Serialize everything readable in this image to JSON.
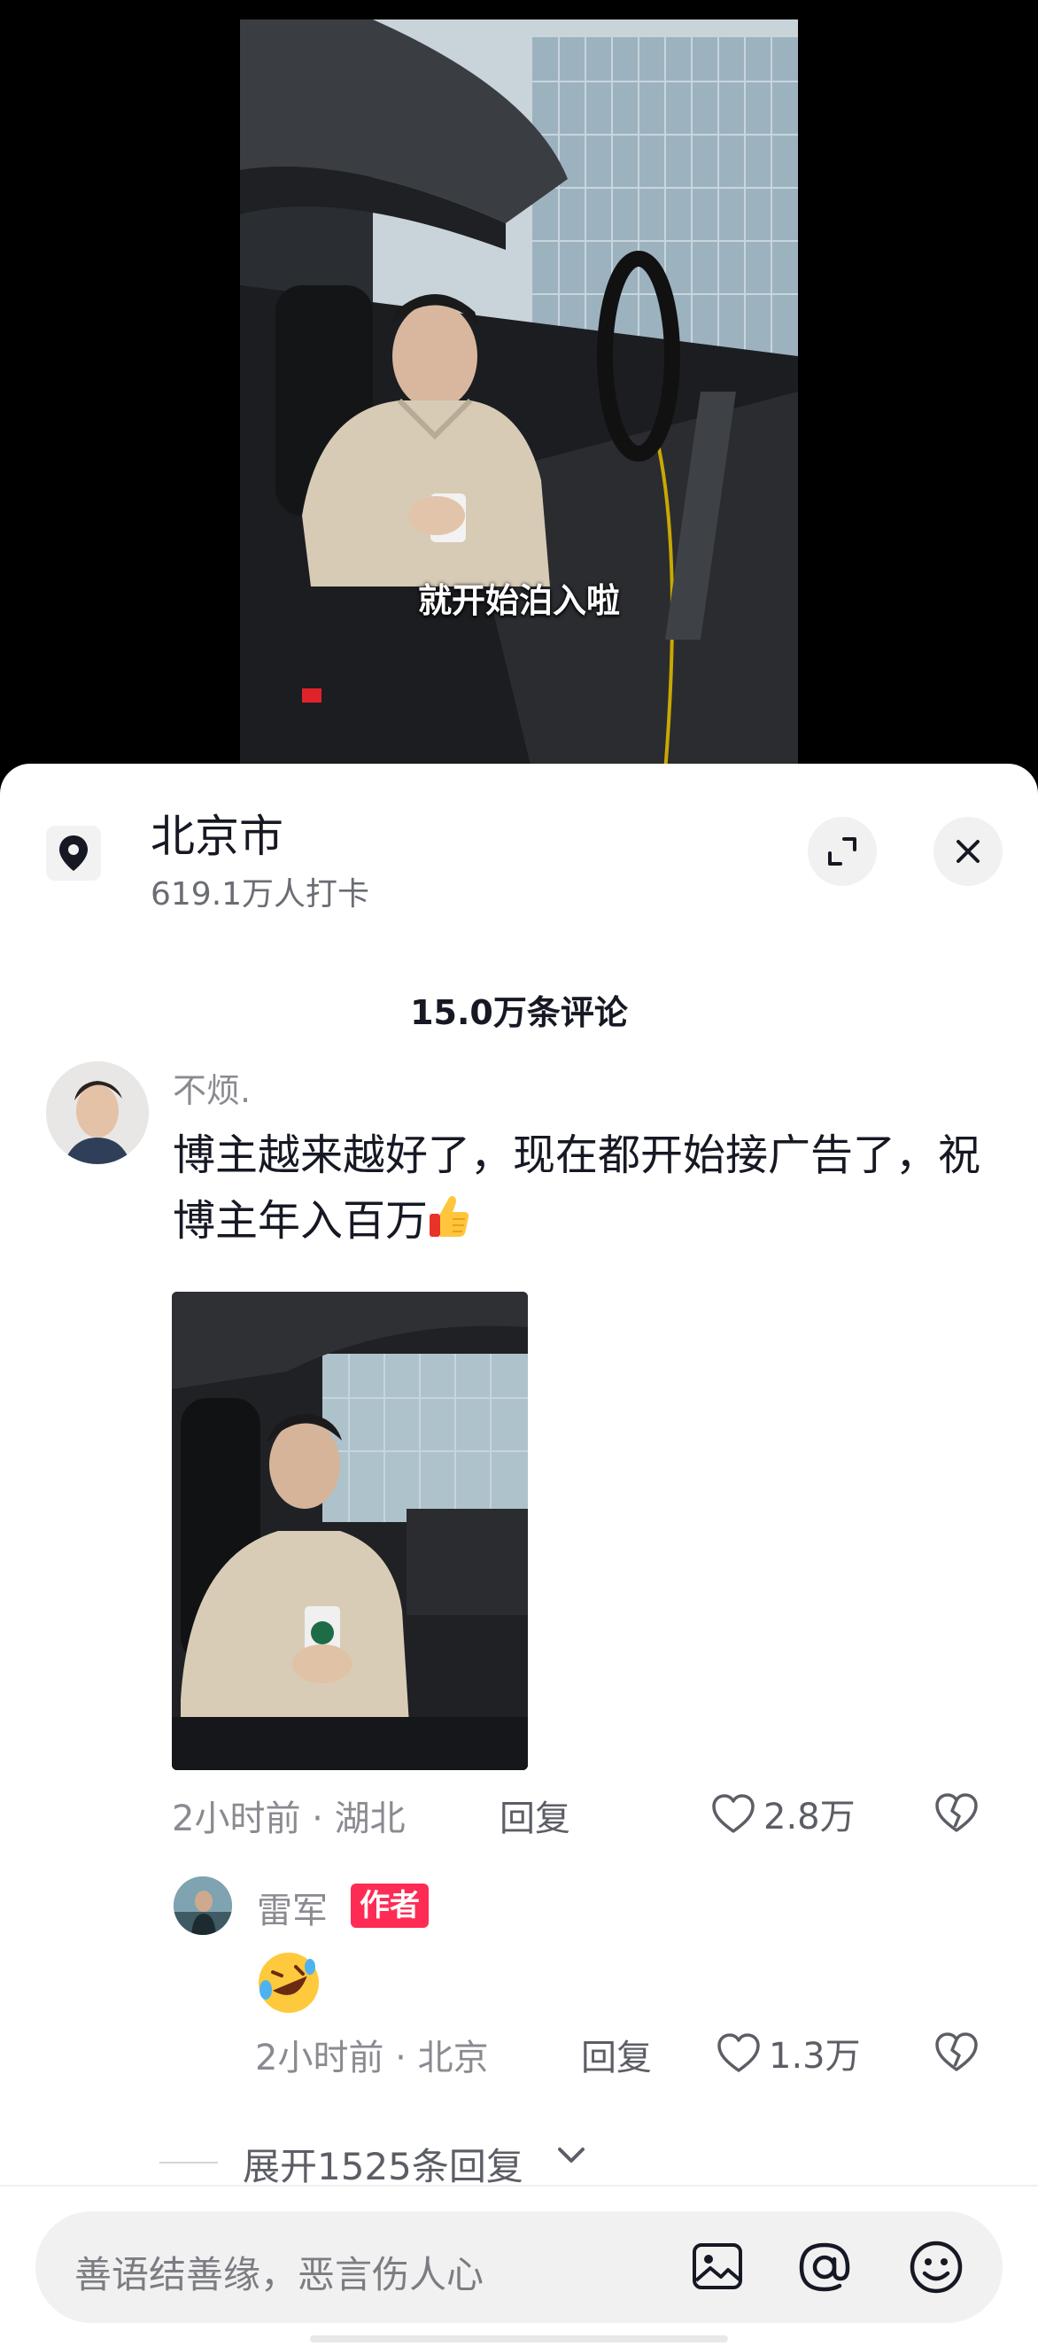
{
  "video": {
    "subtitle": "就开始泊入啦"
  },
  "location": {
    "title": "北京市",
    "checkins": "619.1万人打卡"
  },
  "comments": {
    "count_label": "15.0万条评论",
    "items": [
      {
        "username": "不烦.",
        "text": "博主越来越好了，现在都开始接广告了，祝博主年入百万",
        "emoji": "thumbs-up",
        "time_location": "2小时前 · 湖北",
        "reply_label": "回复",
        "likes": "2.8万",
        "replies": [
          {
            "username": "雷军",
            "badge": "作者",
            "emoji": "rolling-on-floor-laughing",
            "time_location": "2小时前 · 北京",
            "reply_label": "回复",
            "likes": "1.3万"
          }
        ],
        "expand_label": "展开1525条回复"
      }
    ]
  },
  "input_bar": {
    "placeholder": "善语结善缘，恶言伤人心",
    "icons": [
      "image-icon",
      "at-icon",
      "emoji-icon"
    ]
  },
  "colors": {
    "author_badge": "#fe2c55",
    "sheet_bg": "#ffffff",
    "muted_text": "#8a8b91"
  }
}
